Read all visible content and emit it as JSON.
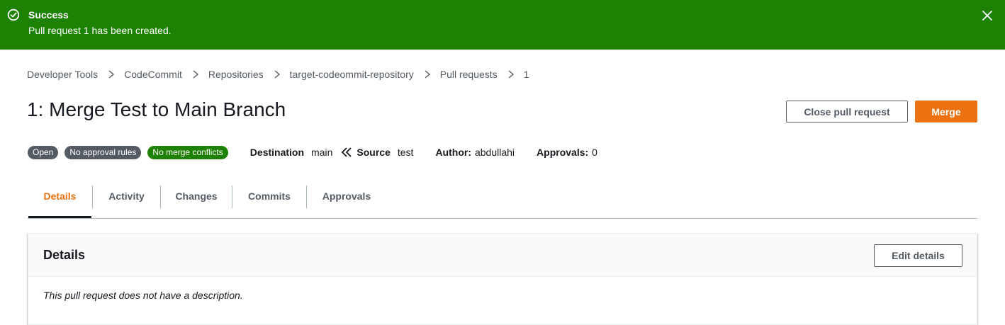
{
  "colors": {
    "success_green": "#1d8102",
    "accent_orange": "#ec7211",
    "text_dark": "#16191f",
    "text_grey": "#545b64",
    "badge_grey": "#545b64"
  },
  "flash": {
    "icon": "check-circle-icon",
    "title": "Success",
    "message": "Pull request 1 has been created.",
    "close_icon": "close-icon"
  },
  "breadcrumb": {
    "items": [
      {
        "label": "Developer Tools"
      },
      {
        "label": "CodeCommit"
      },
      {
        "label": "Repositories"
      },
      {
        "label": "target-codeommit-repository"
      },
      {
        "label": "Pull requests"
      },
      {
        "label": "1"
      }
    ],
    "separator_icon": "chevron-right-icon"
  },
  "page": {
    "title": "1: Merge Test to Main Branch",
    "close_button_label": "Close pull request",
    "merge_button_label": "Merge"
  },
  "meta": {
    "badges": [
      {
        "label": "Open",
        "color": "#545b64"
      },
      {
        "label": "No approval rules",
        "color": "#545b64"
      },
      {
        "label": "No merge conflicts",
        "color": "#1d8102"
      }
    ],
    "destination_label": "Destination",
    "destination_value": "main",
    "direction_icon": "double-chevron-left-icon",
    "source_label": "Source",
    "source_value": "test",
    "author_label": "Author:",
    "author_value": "abdullahi",
    "approvals_label": "Approvals:",
    "approvals_value": "0"
  },
  "tabs": [
    {
      "label": "Details",
      "active": true
    },
    {
      "label": "Activity",
      "active": false
    },
    {
      "label": "Changes",
      "active": false
    },
    {
      "label": "Commits",
      "active": false
    },
    {
      "label": "Approvals",
      "active": false
    }
  ],
  "details_panel": {
    "title": "Details",
    "edit_button_label": "Edit details",
    "description": "This pull request does not have a description."
  }
}
